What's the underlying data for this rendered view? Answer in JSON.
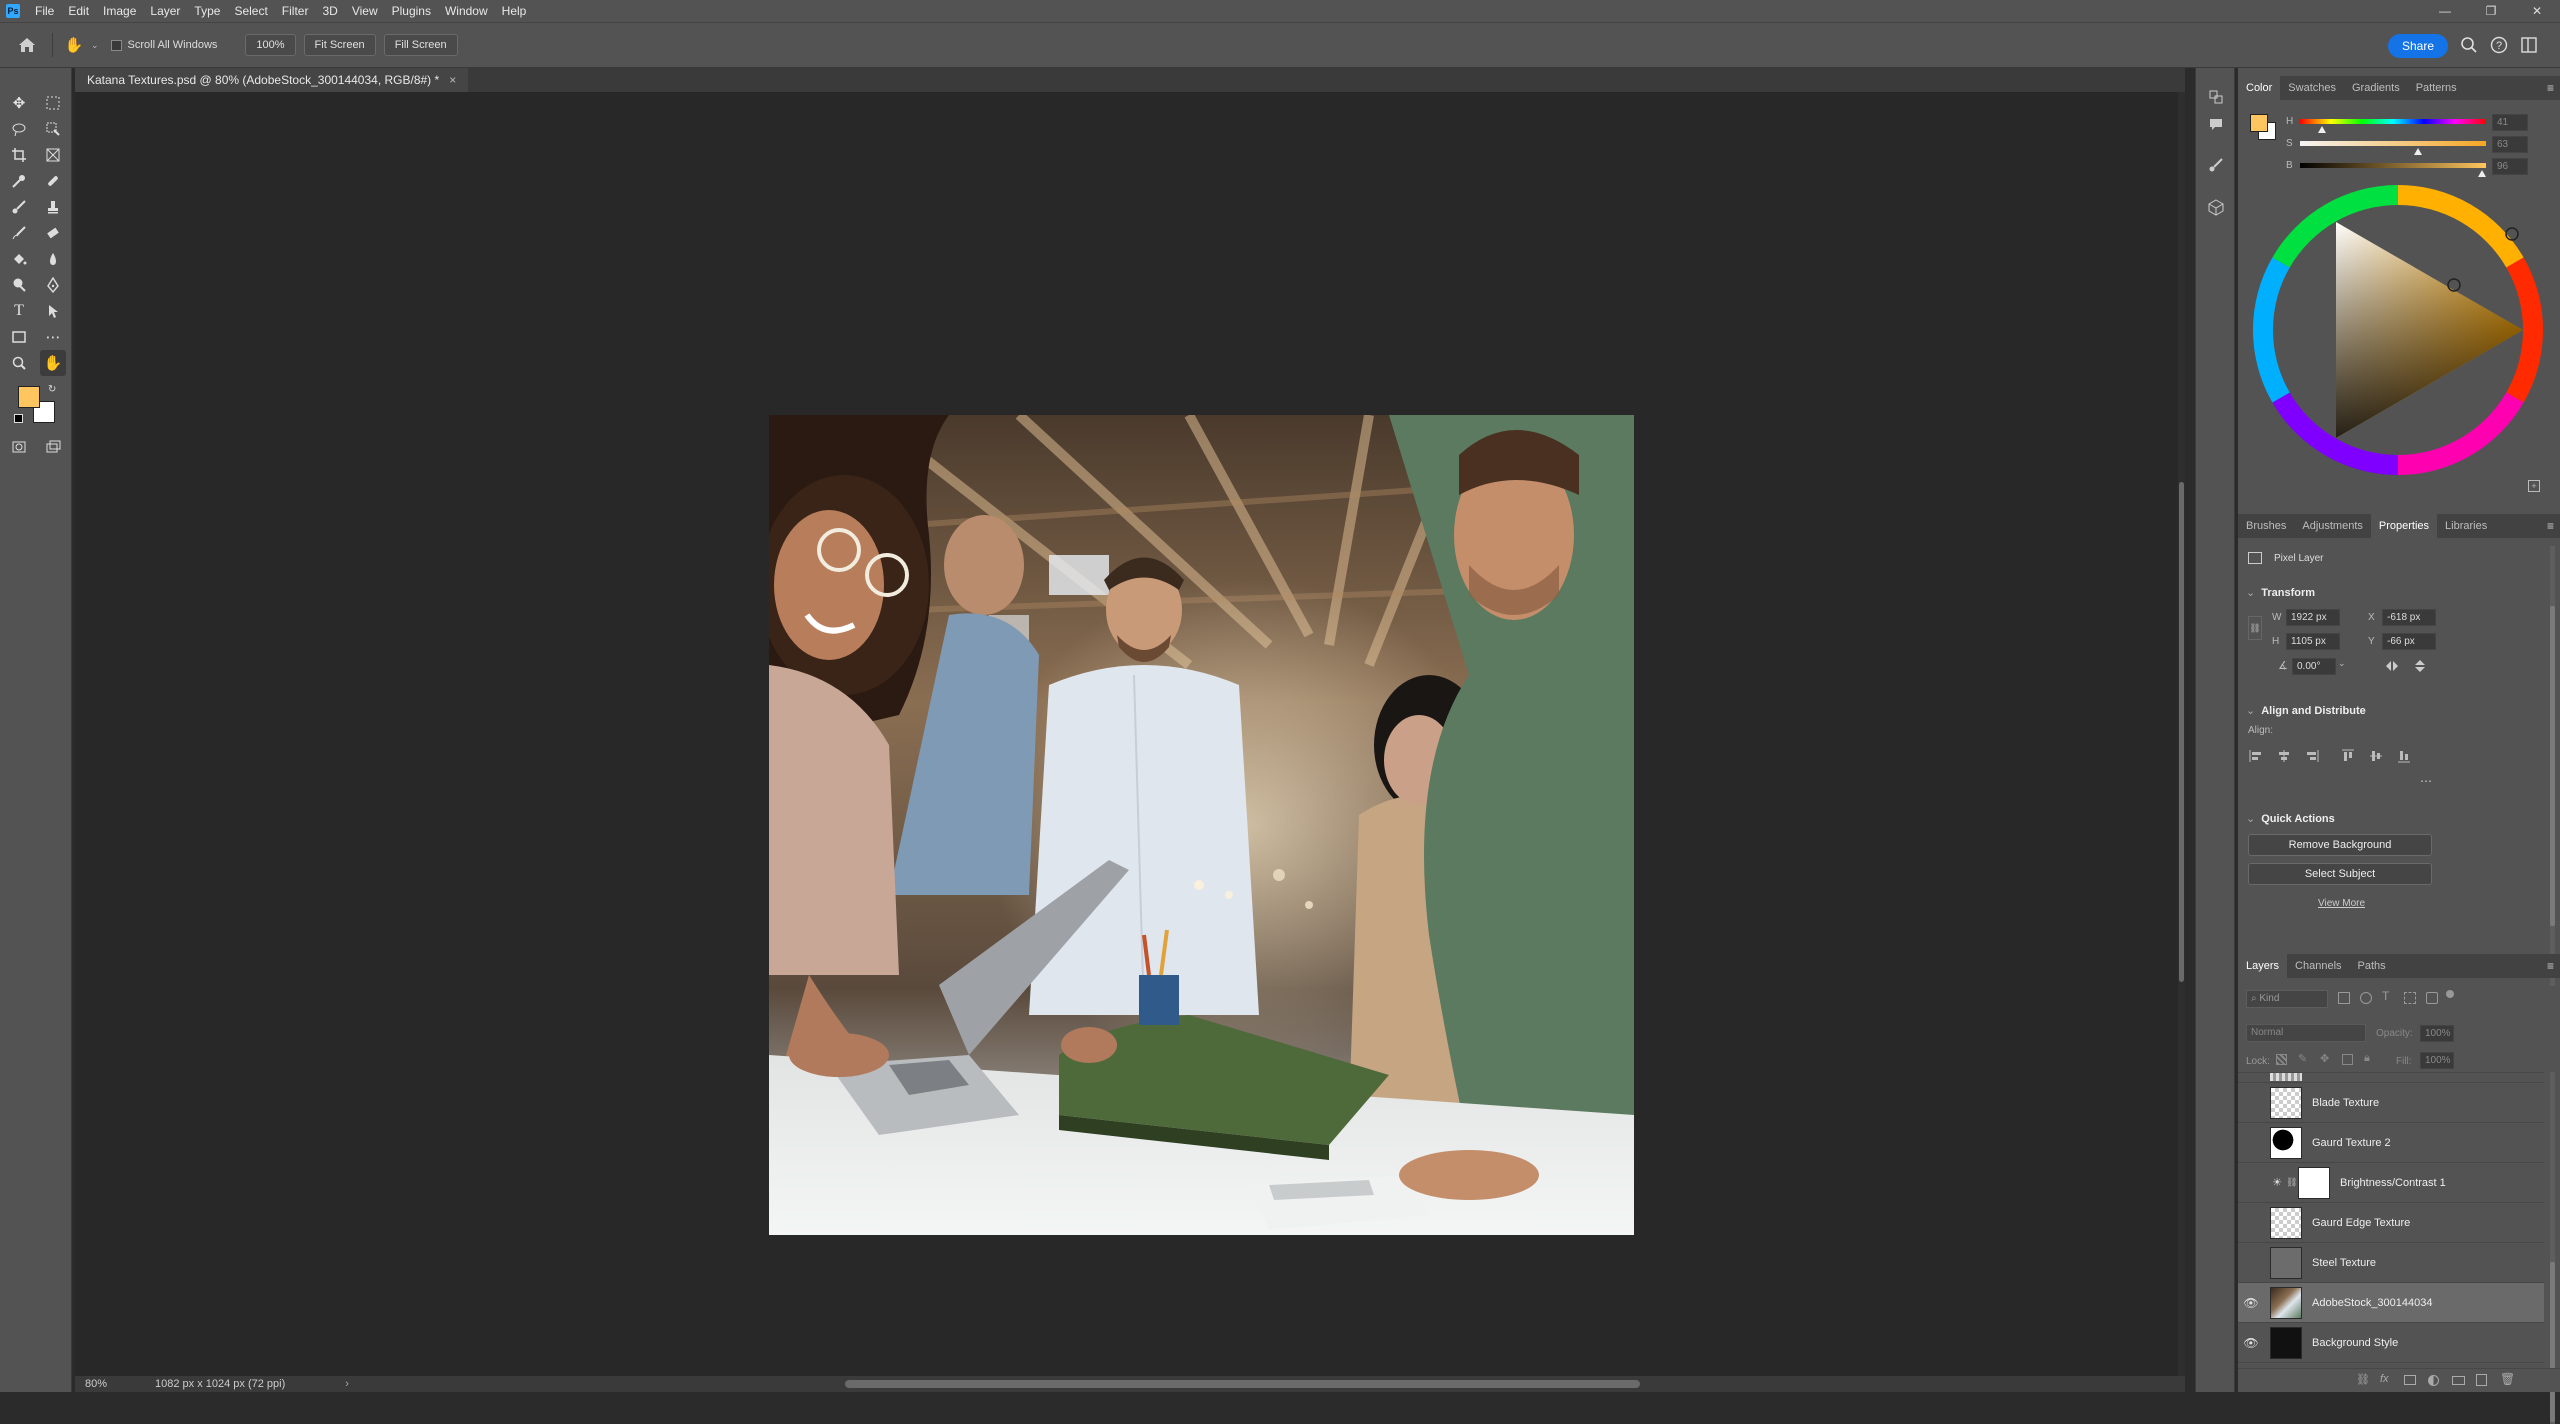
{
  "app": {
    "menu_items": [
      "File",
      "Edit",
      "Image",
      "Layer",
      "Type",
      "Select",
      "Filter",
      "3D",
      "View",
      "Plugins",
      "Window",
      "Help"
    ],
    "window_controls": [
      "—",
      "❐",
      "✕"
    ]
  },
  "options_bar": {
    "scroll_all_windows": "Scroll All Windows",
    "zoom_value": "100%",
    "fit_screen": "Fit Screen",
    "fill_screen": "Fill Screen",
    "share": "Share"
  },
  "document": {
    "tab_title": "Katana Textures.psd @ 80% (AdobeStock_300144034, RGB/8#) *",
    "close": "×"
  },
  "status": {
    "zoom": "80%",
    "dimensions": "1082 px x 1024 px (72 ppi)"
  },
  "color_panel": {
    "tabs": [
      "Color",
      "Swatches",
      "Gradients",
      "Patterns"
    ],
    "active_tab": "Color",
    "h_label": "H",
    "s_label": "S",
    "b_label": "B",
    "h_value": "41",
    "s_value": "63",
    "b_value": "96",
    "foreground_color": "#ffc55e",
    "background_color": "#ffffff"
  },
  "properties_panel": {
    "tabs": [
      "Brushes",
      "Adjustments",
      "Properties",
      "Libraries"
    ],
    "active_tab": "Properties",
    "layer_kind": "Pixel Layer",
    "transform": {
      "heading": "Transform",
      "w_label": "W",
      "w": "1922 px",
      "h_label": "H",
      "h": "1105 px",
      "x_label": "X",
      "x": "-618 px",
      "y_label": "Y",
      "y": "-66 px",
      "angle": "0.00°"
    },
    "align": {
      "heading": "Align and Distribute",
      "label": "Align:"
    },
    "quick_actions": {
      "heading": "Quick Actions",
      "remove_background": "Remove Background",
      "select_subject": "Select Subject",
      "view_more": "View More"
    }
  },
  "layers_panel": {
    "tabs": [
      "Layers",
      "Channels",
      "Paths"
    ],
    "active_tab": "Layers",
    "search_placeholder": "Kind",
    "blend_mode": "Normal",
    "opacity_label": "Opacity:",
    "opacity_value": "100%",
    "lock_label": "Lock:",
    "fill_label": "Fill:",
    "fill_value": "100%",
    "layers": [
      {
        "name": "Blade Texture",
        "visible": false,
        "selected": false
      },
      {
        "name": "Gaurd Texture 2",
        "visible": false,
        "selected": false
      },
      {
        "name": "Brightness/Contrast 1",
        "visible": false,
        "selected": false
      },
      {
        "name": "Gaurd Edge Texture",
        "visible": false,
        "selected": false
      },
      {
        "name": "Steel Texture",
        "visible": false,
        "selected": false
      },
      {
        "name": "AdobeStock_300144034",
        "visible": true,
        "selected": true
      },
      {
        "name": "Background Style",
        "visible": true,
        "selected": false
      }
    ]
  }
}
